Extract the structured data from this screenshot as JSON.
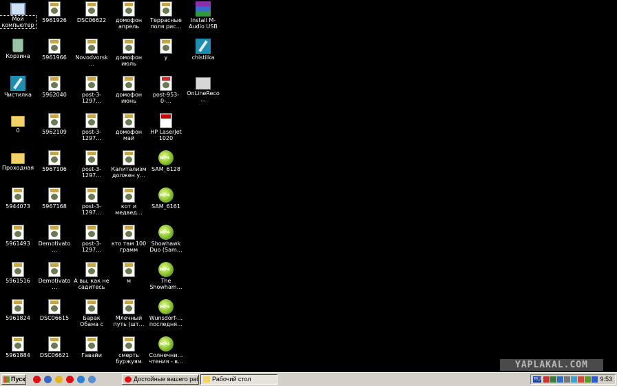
{
  "desktop": {
    "icons": [
      {
        "label": "Мой компьютер",
        "kind": "pc",
        "icon": "my-computer-icon",
        "selected": true
      },
      {
        "label": "Корзина",
        "kind": "bin",
        "icon": "recycle-bin-icon"
      },
      {
        "label": "Чистилка",
        "kind": "clean",
        "icon": "cleaner-app-icon"
      },
      {
        "label": "0",
        "kind": "folder",
        "icon": "folder-icon"
      },
      {
        "label": "Проходная",
        "kind": "folder",
        "icon": "folder-icon"
      },
      {
        "label": "5944073",
        "kind": "jpg",
        "icon": "jpg-file-icon"
      },
      {
        "label": "5961493",
        "kind": "jpg",
        "icon": "jpg-file-icon"
      },
      {
        "label": "5961516",
        "kind": "jpg",
        "icon": "jpg-file-icon"
      },
      {
        "label": "5961824",
        "kind": "jpg",
        "icon": "jpg-file-icon"
      },
      {
        "label": "5961884",
        "kind": "jpg",
        "icon": "jpg-file-icon"
      },
      {
        "label": "5961926",
        "kind": "jpg",
        "icon": "jpg-file-icon"
      },
      {
        "label": "5961966",
        "kind": "jpg",
        "icon": "jpg-file-icon"
      },
      {
        "label": "5962040",
        "kind": "jpg",
        "icon": "jpg-file-icon"
      },
      {
        "label": "5962109",
        "kind": "jpg",
        "icon": "jpg-file-icon"
      },
      {
        "label": "5967106",
        "kind": "jpg",
        "icon": "jpg-file-icon"
      },
      {
        "label": "5967168",
        "kind": "jpg",
        "icon": "jpg-file-icon"
      },
      {
        "label": "Demotivato…",
        "kind": "jpg",
        "icon": "jpg-file-icon"
      },
      {
        "label": "Demotivato…",
        "kind": "jpg",
        "icon": "jpg-file-icon"
      },
      {
        "label": "DSC06615",
        "kind": "jpg",
        "icon": "jpg-file-icon"
      },
      {
        "label": "DSC06621",
        "kind": "jpg",
        "icon": "jpg-file-icon"
      },
      {
        "label": "DSC06622",
        "kind": "jpg",
        "icon": "jpg-file-icon"
      },
      {
        "label": "Novodvorsk…",
        "kind": "jpg",
        "icon": "jpg-file-icon"
      },
      {
        "label": "post-3-1297…",
        "kind": "jpg",
        "icon": "jpg-file-icon"
      },
      {
        "label": "post-3-1297…",
        "kind": "jpg",
        "icon": "jpg-file-icon"
      },
      {
        "label": "post-3-1297…",
        "kind": "jpg",
        "icon": "jpg-file-icon"
      },
      {
        "label": "post-3-1297…",
        "kind": "jpg",
        "icon": "jpg-file-icon"
      },
      {
        "label": "post-3-1297…",
        "kind": "jpg",
        "icon": "jpg-file-icon"
      },
      {
        "label": "А вы, как не садитесь",
        "kind": "jpg",
        "icon": "jpg-file-icon"
      },
      {
        "label": "Барак Обама с хозяином",
        "kind": "jpg",
        "icon": "jpg-file-icon"
      },
      {
        "label": "Гавайи",
        "kind": "jpg",
        "icon": "jpg-file-icon"
      },
      {
        "label": "домофон апрель",
        "kind": "jpg",
        "icon": "jpg-file-icon"
      },
      {
        "label": "домофон июль",
        "kind": "jpg",
        "icon": "jpg-file-icon"
      },
      {
        "label": "домофон июнь",
        "kind": "jpg",
        "icon": "jpg-file-icon"
      },
      {
        "label": "домофон май",
        "kind": "jpg",
        "icon": "jpg-file-icon"
      },
      {
        "label": "Капитализм должен у…",
        "kind": "jpg",
        "icon": "jpg-file-icon"
      },
      {
        "label": "кот и медвед…",
        "kind": "jpg",
        "icon": "jpg-file-icon"
      },
      {
        "label": "кто там 100 грамм",
        "kind": "jpg",
        "icon": "jpg-file-icon"
      },
      {
        "label": "м",
        "kind": "jpg",
        "icon": "jpg-file-icon"
      },
      {
        "label": "Млечный путь (шт…",
        "kind": "jpg",
        "icon": "jpg-file-icon"
      },
      {
        "label": "смерть буржуям",
        "kind": "jpg",
        "icon": "jpg-file-icon"
      },
      {
        "label": "Террасные поля рис…",
        "kind": "jpg",
        "icon": "jpg-file-icon"
      },
      {
        "label": "у",
        "kind": "jpg",
        "icon": "jpg-file-icon"
      },
      {
        "label": "post-953-0-…",
        "kind": "png",
        "icon": "png-file-icon"
      },
      {
        "label": "HP LaserJet 1020",
        "kind": "pdf",
        "icon": "pdf-file-icon"
      },
      {
        "label": "SAM_6128",
        "kind": "mp4",
        "icon": "mp4-file-icon"
      },
      {
        "label": "SAM_6161",
        "kind": "mp4",
        "icon": "mp4-file-icon"
      },
      {
        "label": "Showhawk Duo (Sam…",
        "kind": "mp4",
        "icon": "mp4-file-icon"
      },
      {
        "label": "The Showham…",
        "kind": "mp4",
        "icon": "mp4-file-icon"
      },
      {
        "label": "Wunsdorf-… последня…",
        "kind": "mp4",
        "icon": "mp4-file-icon"
      },
      {
        "label": "Солнечни… чтения - в…",
        "kind": "mp4",
        "icon": "mp4-file-icon"
      },
      {
        "label": "Install M-Audio USB MIDI S…",
        "kind": "rar",
        "icon": "winrar-archive-icon"
      },
      {
        "label": "chistilka",
        "kind": "clean",
        "icon": "cleaner-app-icon"
      },
      {
        "label": "OnLineReco…",
        "kind": "exe",
        "icon": "online-recorder-app-icon"
      }
    ]
  },
  "watermark": "YAPLAKAL.COM",
  "taskbar": {
    "start_label": "Пуск",
    "quick_launch": [
      {
        "icon": "opera-icon",
        "color": "#d11"
      },
      {
        "icon": "firefox-icon",
        "color": "#3a66c4"
      },
      {
        "icon": "chrome-icon",
        "color": "#e2b622"
      },
      {
        "icon": "opera-icon",
        "color": "#d11"
      },
      {
        "icon": "internet-explorer-icon",
        "color": "#2c7fd4"
      },
      {
        "icon": "show-desktop-icon",
        "color": "#5b8ed1"
      }
    ],
    "tasks": [
      {
        "label": "Достойные вашего раб…",
        "icon": "opera-icon",
        "active": false
      },
      {
        "label": "Рабочий стол",
        "icon": "folder-icon",
        "active": true
      }
    ],
    "tray_icons": [
      "language-indicator-icon",
      "antivirus-icon",
      "network-icon",
      "volume-icon",
      "monitor-icon",
      "shield-icon",
      "update-icon",
      "speaker-icon",
      "safely-remove-icon"
    ],
    "language": "RU",
    "clock": "9:53"
  },
  "colors": {
    "desktop_bg": "#000000",
    "taskbar_bg": "#d4d0c8"
  }
}
